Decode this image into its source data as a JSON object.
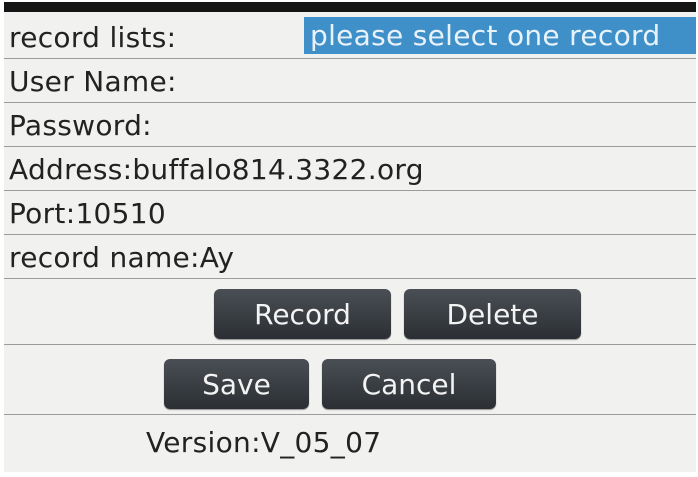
{
  "form": {
    "record_lists_label": "record lists:",
    "record_select_value": "please select one record",
    "user_name_label": "User Name:",
    "password_label": "Password:",
    "address_text": "Address:buffalo814.3322.org",
    "port_text": "Port:10510",
    "record_name_text": "record name:Ay"
  },
  "buttons": {
    "record": "Record",
    "delete": "Delete",
    "save": "Save",
    "cancel": "Cancel"
  },
  "footer": {
    "version": "Version:V_05_07"
  },
  "colors": {
    "selection_highlight": "#3f90c9",
    "button_bg": "#2b2f33",
    "background": "#f1f1ef"
  }
}
